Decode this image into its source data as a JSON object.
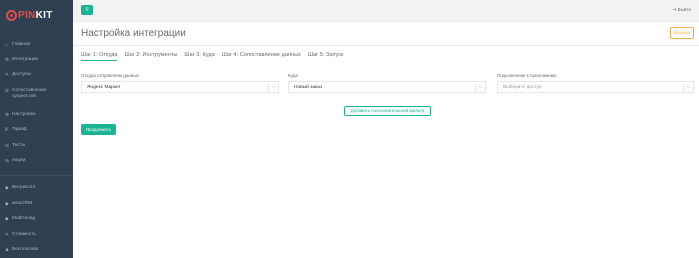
{
  "logo": {
    "prefix": "PIN",
    "accent": "K",
    "suffix": "IT"
  },
  "sidebar": {
    "items": [
      {
        "icon": "⌂",
        "label": "Главная"
      },
      {
        "icon": "⚙",
        "label": "Интеграции"
      },
      {
        "icon": "✎",
        "label": "Доступы"
      },
      {
        "icon": "⇄",
        "label": "Сопоставление\nсущностей"
      },
      {
        "icon": "⚙",
        "label": "Настройки"
      },
      {
        "icon": "₽",
        "label": "Тариф"
      },
      {
        "icon": "✉",
        "label": "Тесты"
      },
      {
        "icon": "%",
        "label": "Акции"
      },
      {
        "icon": "◆",
        "label": "Битрикс24"
      },
      {
        "icon": "◆",
        "label": "amoCRM"
      },
      {
        "icon": "◆",
        "label": "МойСклад"
      },
      {
        "icon": "✎",
        "label": "Стоимость"
      },
      {
        "icon": "♟",
        "label": "Бесплатная"
      }
    ]
  },
  "topbar": {
    "menu_icon": "≡",
    "exit_label": "Выйти"
  },
  "page": {
    "title": "Настройка интеграции",
    "journal_label": "Журнал"
  },
  "tabs": [
    "Шаг 1: Откуда",
    "Шаг 2: Инструменты",
    "Шаг 3: Куда",
    "Шаг 4: Сопоставление данных",
    "Шаг 5: Запуск"
  ],
  "form": {
    "source": {
      "label": "Откуда отправляем данные",
      "value": "Яндекс Маркет"
    },
    "target": {
      "label": "Куда",
      "value": "Новый заказ"
    },
    "app": {
      "label": "Подключение к приложению",
      "placeholder": "Выберите доступ"
    },
    "custom_filter_label": "Добавить пользовательский фильтр",
    "continue_label": "Продолжить"
  },
  "colors": {
    "sidebar_bg": "#2f4050",
    "accent": "#1ab394",
    "logo_accent": "#e24b4b",
    "journal_border": "#f0ad4e"
  }
}
